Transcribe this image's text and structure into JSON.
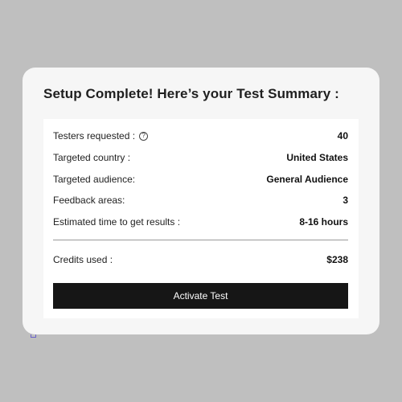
{
  "summary": {
    "title": "Setup Complete! Here’s your Test Summary :",
    "rows": [
      {
        "label": "Testers requested :",
        "value": "40",
        "icon": "help-circle-icon"
      },
      {
        "label": "Targeted country :",
        "value": "United States"
      },
      {
        "label": "Targeted audience:",
        "value": "General Audience"
      },
      {
        "label": "Feedback areas:",
        "value": "3"
      },
      {
        "label": "Estimated time to get results :",
        "value": "8-16 hours"
      }
    ],
    "credits": {
      "label": "Credits used :",
      "value": "$238"
    },
    "activate_label": "Activate Test",
    "help_glyph": "?"
  },
  "colors": {
    "background": "#bfbfbf",
    "card": "#f6f6f6",
    "panel": "#ffffff",
    "button": "#161616",
    "checkbox_accent": "#6b63c9"
  }
}
